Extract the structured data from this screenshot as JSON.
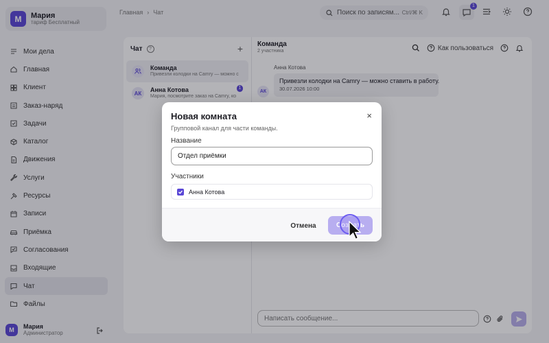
{
  "sidebar": {
    "profile": {
      "initial": "М",
      "name": "Мария",
      "plan": "тариф Бесплатный"
    },
    "items": [
      {
        "label": "Мои дела",
        "icon": "checklist-icon"
      },
      {
        "label": "Главная",
        "icon": "home-icon"
      },
      {
        "label": "Клиент",
        "icon": "grid-icon"
      },
      {
        "label": "Заказ-наряд",
        "icon": "order-icon"
      },
      {
        "label": "Задачи",
        "icon": "tasks-icon"
      },
      {
        "label": "Каталог",
        "icon": "box-icon"
      },
      {
        "label": "Движения",
        "icon": "document-icon"
      },
      {
        "label": "Услуги",
        "icon": "wrench-icon"
      },
      {
        "label": "Ресурсы",
        "icon": "tool-icon"
      },
      {
        "label": "Записи",
        "icon": "calendar-icon"
      },
      {
        "label": "Приёмка",
        "icon": "car-icon"
      },
      {
        "label": "Согласования",
        "icon": "approval-icon"
      },
      {
        "label": "Входящие",
        "icon": "inbox-icon"
      },
      {
        "label": "Чат",
        "icon": "chat-icon"
      },
      {
        "label": "Файлы",
        "icon": "folder-icon"
      }
    ],
    "active_index": 13,
    "user": {
      "initial": "М",
      "name": "Мария",
      "role": "Администратор"
    }
  },
  "topbar": {
    "breadcrumb": [
      "Главная",
      "Чат"
    ],
    "search": {
      "placeholder": "Поиск по записям...",
      "shortcut": "Ctrl/⌘ K"
    },
    "chat_badge": "1"
  },
  "chat_list": {
    "title": "Чат",
    "items": [
      {
        "icon": "group-icon",
        "title": "Команда",
        "preview": "Привезли колодки на Camry — можно с"
      },
      {
        "initials": "АК",
        "title": "Анна Котова",
        "preview": "Мария, посмотрите заказ на Camry, ко",
        "badge": "1"
      }
    ]
  },
  "conversation": {
    "title": "Команда",
    "subtitle": "2 участника",
    "how_to": "Как пользоваться",
    "message": {
      "author": "Анна Котова",
      "initials": "АК",
      "text": "Привезли колодки на Camry — можно ставить в работу.",
      "time": "30.07.2026 10:00"
    },
    "composer_placeholder": "Написать сообщение..."
  },
  "modal": {
    "title": "Новая комната",
    "description": "Групповой канал для части команды.",
    "name_label": "Название",
    "name_value": "Отдел приёмки",
    "members_label": "Участники",
    "members": [
      {
        "name": "Анна Котова",
        "checked": true
      }
    ],
    "cancel": "Отмена",
    "create": "Создать",
    "close": "×"
  },
  "colors": {
    "accent": "#5a47d6",
    "accent_light": "#b8aef0"
  }
}
